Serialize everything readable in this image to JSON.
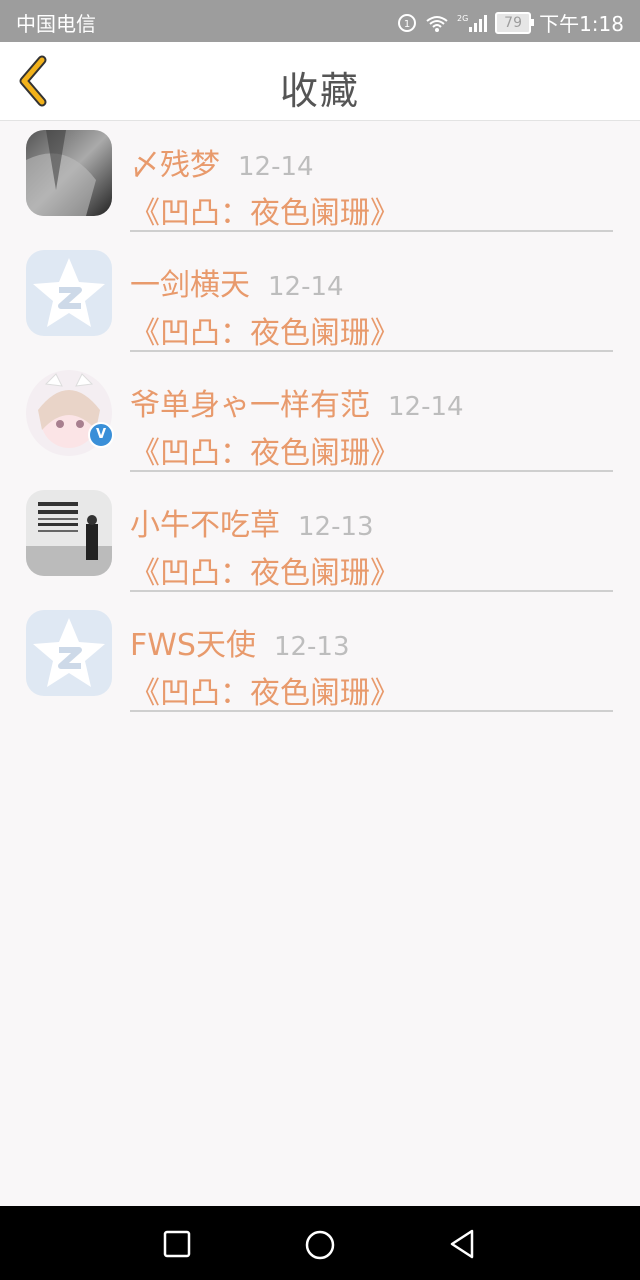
{
  "status_bar": {
    "carrier": "中国电信",
    "network": "2G",
    "battery": "79",
    "time": "下午1:18"
  },
  "header": {
    "title": "收藏",
    "back_icon": "chevron-left-icon",
    "accent_color": "#f2b21b"
  },
  "favorites": [
    {
      "name": "〆残梦",
      "date": "12-14",
      "post": "《凹凸：夜色阑珊》",
      "avatar": "photo-avatar"
    },
    {
      "name": "一剑横天",
      "date": "12-14",
      "post": "《凹凸：夜色阑珊》",
      "avatar": "qq-default-avatar"
    },
    {
      "name": "爷单身ゃ一样有范",
      "date": "12-14",
      "post": "《凹凸：夜色阑珊》",
      "avatar": "anime-avatar",
      "verified": true
    },
    {
      "name": "小牛不吃草",
      "date": "12-13",
      "post": "《凹凸：夜色阑珊》",
      "avatar": "poster-avatar"
    },
    {
      "name": "FWS天使",
      "date": "12-13",
      "post": "《凹凸：夜色阑珊》",
      "avatar": "qq-default-avatar"
    }
  ],
  "verified_badge": "V",
  "nav_bar": {
    "recent": "square-icon",
    "home": "circle-icon",
    "back": "triangle-back-icon"
  },
  "colors": {
    "name_text": "#e89a6c",
    "date_text": "#bdbdbd",
    "background": "#f9f7f8"
  }
}
